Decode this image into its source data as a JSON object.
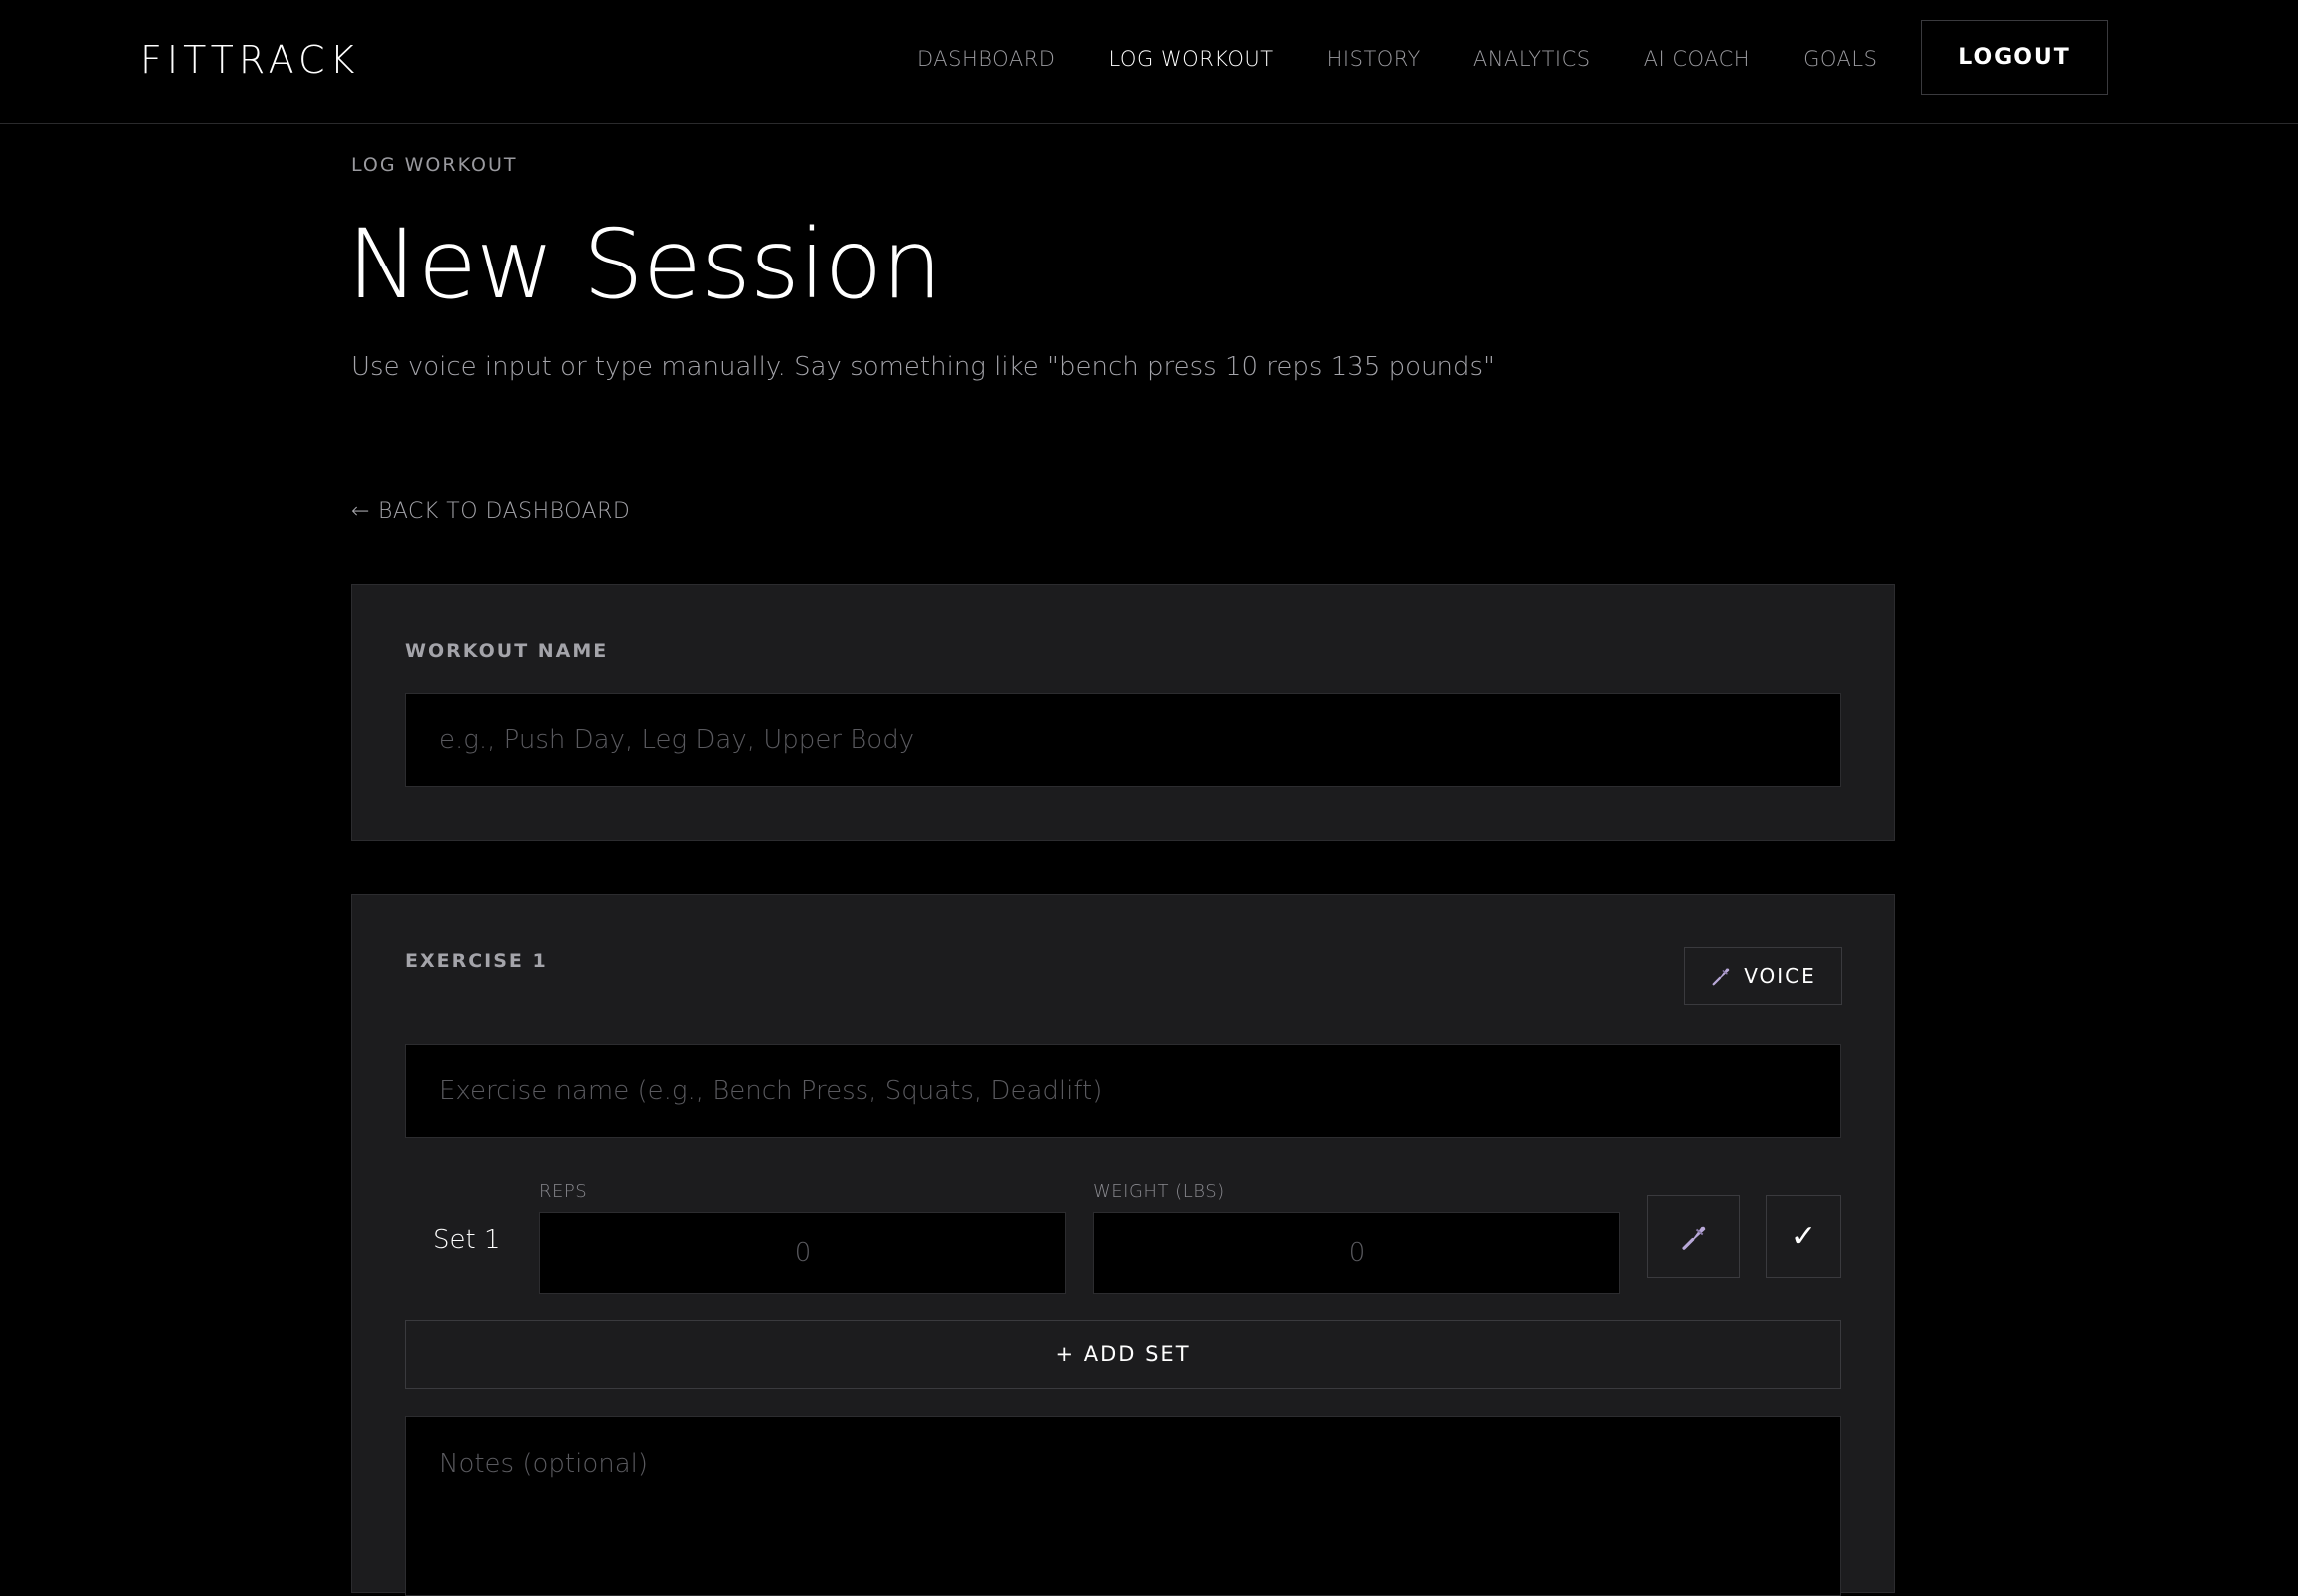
{
  "app": {
    "logo": "FITTRACK"
  },
  "nav": {
    "links": [
      {
        "label": "DASHBOARD",
        "active": false
      },
      {
        "label": "LOG WORKOUT",
        "active": true
      },
      {
        "label": "HISTORY",
        "active": false
      },
      {
        "label": "ANALYTICS",
        "active": false
      },
      {
        "label": "AI COACH",
        "active": false
      },
      {
        "label": "GOALS",
        "active": false
      }
    ],
    "logout_label": "LOGOUT"
  },
  "header": {
    "eyebrow": "LOG WORKOUT",
    "title": "New Session",
    "subtitle": "Use voice input or type manually. Say something like \"bench press 10 reps 135 pounds\"",
    "back_label": "BACK TO DASHBOARD",
    "back_arrow": "←"
  },
  "workout": {
    "label": "WORKOUT NAME",
    "value": "",
    "placeholder": "e.g., Push Day, Leg Day, Upper Body"
  },
  "exercise": {
    "label": "EXERCISE 1",
    "voice_label": "VOICE",
    "voice_icon": "microphone-icon",
    "name_value": "",
    "name_placeholder": "Exercise name (e.g., Bench Press, Squats, Deadlift)",
    "sets": [
      {
        "label": "Set 1",
        "reps_label": "REPS",
        "reps_placeholder": "0",
        "weight_label": "WEIGHT (LBS)",
        "weight_placeholder": "0",
        "mic_icon": "microphone-icon",
        "check_glyph": "✓"
      }
    ],
    "add_set_label": "+ ADD SET",
    "notes_placeholder": "Notes (optional)"
  },
  "colors": {
    "background": "#000000",
    "panel": "#1c1c1e",
    "text_primary": "#ffffff",
    "text_muted": "#9a9a9f",
    "mic_accent": "#b8a8d8"
  }
}
